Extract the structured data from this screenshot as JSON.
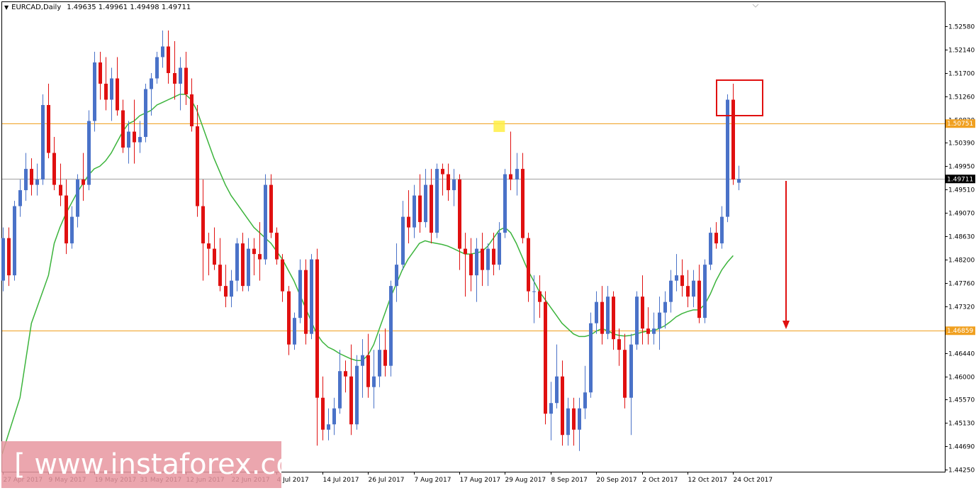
{
  "header": {
    "symbol": "EURCAD,Daily",
    "ohlc": "1.49635 1.49961 1.49498 1.49711"
  },
  "watermark": {
    "text": "[ www.instaforex.com ]"
  },
  "colors": {
    "bull": "#4a72c8",
    "bear": "#e01010",
    "ma": "#3cb43c",
    "hline": "#f0a020",
    "current": "#a0a0a0",
    "annotation": "#e01010",
    "highlight": "#ffee44"
  },
  "chart_data": {
    "type": "candlestick",
    "symbol": "EURCAD",
    "timeframe": "Daily",
    "ylim": [
      1.4425,
      1.528
    ],
    "y_ticks": [
      "1.52580",
      "1.52140",
      "1.51700",
      "1.51260",
      "1.50820",
      "1.50390",
      "1.49950",
      "1.49510",
      "1.49070",
      "1.48630",
      "1.48200",
      "1.47760",
      "1.47320",
      "1.46880",
      "1.46440",
      "1.46000",
      "1.45570",
      "1.45130",
      "1.44690",
      "1.44250"
    ],
    "x_labels": [
      "27 Apr 2017",
      "9 May 2017",
      "19 May 2017",
      "31 May 2017",
      "12 Jun 2017",
      "22 Jun 2017",
      "4 Jul 2017",
      "14 Jul 2017",
      "26 Jul 2017",
      "7 Aug 2017",
      "17 Aug 2017",
      "29 Aug 2017",
      "8 Sep 2017",
      "20 Sep 2017",
      "2 Oct 2017",
      "12 Oct 2017",
      "24 Oct 2017"
    ],
    "x_label_index": [
      0,
      8,
      16,
      24,
      32,
      40,
      48,
      56,
      64,
      72,
      80,
      88,
      96,
      104,
      112,
      120,
      128
    ],
    "horizontal_levels": [
      {
        "value": 1.50751,
        "label": "1.50751"
      },
      {
        "value": 1.46859,
        "label": "1.46859"
      }
    ],
    "current_price": {
      "value": 1.49711,
      "label": "1.49711"
    },
    "ohlc": [
      [
        1.478,
        1.488,
        1.476,
        1.486
      ],
      [
        1.486,
        1.488,
        1.477,
        1.479
      ],
      [
        1.479,
        1.493,
        1.478,
        1.492
      ],
      [
        1.492,
        1.497,
        1.49,
        1.495
      ],
      [
        1.495,
        1.502,
        1.493,
        1.499
      ],
      [
        1.499,
        1.501,
        1.494,
        1.496
      ],
      [
        1.496,
        1.5,
        1.494,
        1.497
      ],
      [
        1.497,
        1.513,
        1.496,
        1.511
      ],
      [
        1.511,
        1.515,
        1.501,
        1.502
      ],
      [
        1.502,
        1.505,
        1.495,
        1.496
      ],
      [
        1.496,
        1.5,
        1.492,
        1.494
      ],
      [
        1.494,
        1.497,
        1.483,
        1.485
      ],
      [
        1.485,
        1.492,
        1.484,
        1.49
      ],
      [
        1.49,
        1.498,
        1.488,
        1.497
      ],
      [
        1.497,
        1.502,
        1.493,
        1.496
      ],
      [
        1.496,
        1.51,
        1.495,
        1.508
      ],
      [
        1.508,
        1.521,
        1.506,
        1.519
      ],
      [
        1.519,
        1.521,
        1.512,
        1.515
      ],
      [
        1.515,
        1.52,
        1.51,
        1.512
      ],
      [
        1.512,
        1.518,
        1.508,
        1.516
      ],
      [
        1.516,
        1.52,
        1.509,
        1.51
      ],
      [
        1.51,
        1.512,
        1.502,
        1.503
      ],
      [
        1.503,
        1.508,
        1.5,
        1.506
      ],
      [
        1.506,
        1.512,
        1.5,
        1.504
      ],
      [
        1.504,
        1.508,
        1.502,
        1.505
      ],
      [
        1.505,
        1.515,
        1.504,
        1.514
      ],
      [
        1.514,
        1.517,
        1.509,
        1.516
      ],
      [
        1.516,
        1.521,
        1.515,
        1.52
      ],
      [
        1.52,
        1.525,
        1.518,
        1.522
      ],
      [
        1.522,
        1.525,
        1.515,
        1.517
      ],
      [
        1.517,
        1.523,
        1.512,
        1.515
      ],
      [
        1.515,
        1.52,
        1.51,
        1.518
      ],
      [
        1.518,
        1.521,
        1.511,
        1.513
      ],
      [
        1.513,
        1.516,
        1.506,
        1.507
      ],
      [
        1.507,
        1.511,
        1.49,
        1.492
      ],
      [
        1.492,
        1.497,
        1.478,
        1.485
      ],
      [
        1.485,
        1.487,
        1.479,
        1.484
      ],
      [
        1.484,
        1.488,
        1.48,
        1.481
      ],
      [
        1.481,
        1.486,
        1.476,
        1.477
      ],
      [
        1.477,
        1.481,
        1.473,
        1.475
      ],
      [
        1.475,
        1.48,
        1.473,
        1.478
      ],
      [
        1.478,
        1.486,
        1.476,
        1.485
      ],
      [
        1.485,
        1.487,
        1.476,
        1.477
      ],
      [
        1.477,
        1.486,
        1.476,
        1.484
      ],
      [
        1.484,
        1.486,
        1.479,
        1.483
      ],
      [
        1.483,
        1.489,
        1.478,
        1.482
      ],
      [
        1.482,
        1.498,
        1.481,
        1.496
      ],
      [
        1.496,
        1.498,
        1.486,
        1.487
      ],
      [
        1.487,
        1.488,
        1.481,
        1.482
      ],
      [
        1.482,
        1.483,
        1.474,
        1.476
      ],
      [
        1.476,
        1.477,
        1.464,
        1.466
      ],
      [
        1.466,
        1.472,
        1.465,
        1.471
      ],
      [
        1.471,
        1.482,
        1.47,
        1.48
      ],
      [
        1.48,
        1.482,
        1.466,
        1.468
      ],
      [
        1.468,
        1.483,
        1.467,
        1.482
      ],
      [
        1.482,
        1.484,
        1.447,
        1.456
      ],
      [
        1.456,
        1.46,
        1.448,
        1.45
      ],
      [
        1.45,
        1.454,
        1.448,
        1.451
      ],
      [
        1.451,
        1.456,
        1.449,
        1.454
      ],
      [
        1.454,
        1.465,
        1.453,
        1.461
      ],
      [
        1.461,
        1.463,
        1.457,
        1.46
      ],
      [
        1.46,
        1.466,
        1.449,
        1.451
      ],
      [
        1.451,
        1.464,
        1.45,
        1.462
      ],
      [
        1.462,
        1.467,
        1.456,
        1.464
      ],
      [
        1.464,
        1.468,
        1.456,
        1.458
      ],
      [
        1.458,
        1.465,
        1.454,
        1.46
      ],
      [
        1.46,
        1.468,
        1.458,
        1.465
      ],
      [
        1.465,
        1.469,
        1.46,
        1.462
      ],
      [
        1.462,
        1.478,
        1.46,
        1.477
      ],
      [
        1.477,
        1.485,
        1.474,
        1.481
      ],
      [
        1.481,
        1.493,
        1.48,
        1.49
      ],
      [
        1.49,
        1.495,
        1.485,
        1.488
      ],
      [
        1.488,
        1.496,
        1.486,
        1.494
      ],
      [
        1.494,
        1.498,
        1.487,
        1.489
      ],
      [
        1.489,
        1.499,
        1.488,
        1.496
      ],
      [
        1.496,
        1.499,
        1.485,
        1.487
      ],
      [
        1.487,
        1.5,
        1.486,
        1.499
      ],
      [
        1.499,
        1.5,
        1.494,
        1.498
      ],
      [
        1.498,
        1.5,
        1.493,
        1.495
      ],
      [
        1.495,
        1.499,
        1.492,
        1.497
      ],
      [
        1.497,
        1.498,
        1.48,
        1.484
      ],
      [
        1.484,
        1.487,
        1.475,
        1.483
      ],
      [
        1.483,
        1.486,
        1.476,
        1.479
      ],
      [
        1.479,
        1.486,
        1.474,
        1.484
      ],
      [
        1.484,
        1.487,
        1.477,
        1.48
      ],
      [
        1.48,
        1.485,
        1.477,
        1.484
      ],
      [
        1.484,
        1.487,
        1.479,
        1.481
      ],
      [
        1.481,
        1.489,
        1.48,
        1.487
      ],
      [
        1.487,
        1.499,
        1.486,
        1.498
      ],
      [
        1.498,
        1.506,
        1.495,
        1.497
      ],
      [
        1.497,
        1.502,
        1.494,
        1.499
      ],
      [
        1.499,
        1.502,
        1.485,
        1.486
      ],
      [
        1.486,
        1.487,
        1.474,
        1.476
      ],
      [
        1.476,
        1.479,
        1.47,
        1.476
      ],
      [
        1.476,
        1.479,
        1.471,
        1.474
      ],
      [
        1.474,
        1.476,
        1.451,
        1.453
      ],
      [
        1.453,
        1.459,
        1.448,
        1.455
      ],
      [
        1.455,
        1.466,
        1.454,
        1.46
      ],
      [
        1.46,
        1.463,
        1.447,
        1.449
      ],
      [
        1.449,
        1.456,
        1.447,
        1.454
      ],
      [
        1.454,
        1.456,
        1.447,
        1.45
      ],
      [
        1.45,
        1.456,
        1.446,
        1.454
      ],
      [
        1.454,
        1.462,
        1.452,
        1.457
      ],
      [
        1.457,
        1.472,
        1.456,
        1.47
      ],
      [
        1.47,
        1.476,
        1.468,
        1.474
      ],
      [
        1.474,
        1.477,
        1.466,
        1.468
      ],
      [
        1.468,
        1.477,
        1.467,
        1.475
      ],
      [
        1.475,
        1.476,
        1.465,
        1.467
      ],
      [
        1.467,
        1.469,
        1.462,
        1.465
      ],
      [
        1.465,
        1.468,
        1.454,
        1.456
      ],
      [
        1.456,
        1.468,
        1.449,
        1.466
      ],
      [
        1.466,
        1.476,
        1.465,
        1.475
      ],
      [
        1.475,
        1.479,
        1.466,
        1.469
      ],
      [
        1.469,
        1.473,
        1.466,
        1.468
      ],
      [
        1.468,
        1.472,
        1.466,
        1.469
      ],
      [
        1.469,
        1.475,
        1.465,
        1.472
      ],
      [
        1.472,
        1.476,
        1.469,
        1.474
      ],
      [
        1.474,
        1.48,
        1.472,
        1.478
      ],
      [
        1.478,
        1.483,
        1.476,
        1.479
      ],
      [
        1.479,
        1.482,
        1.475,
        1.477
      ],
      [
        1.477,
        1.48,
        1.473,
        1.475
      ],
      [
        1.475,
        1.48,
        1.473,
        1.478
      ],
      [
        1.478,
        1.481,
        1.47,
        1.471
      ],
      [
        1.471,
        1.482,
        1.47,
        1.481
      ],
      [
        1.481,
        1.488,
        1.48,
        1.487
      ],
      [
        1.487,
        1.489,
        1.484,
        1.485
      ],
      [
        1.485,
        1.492,
        1.484,
        1.49
      ],
      [
        1.49,
        1.513,
        1.489,
        1.512
      ],
      [
        1.512,
        1.515,
        1.496,
        1.497
      ],
      [
        1.4964,
        1.4996,
        1.495,
        1.4971
      ]
    ],
    "ma": [
      null,
      null,
      null,
      null,
      null,
      null,
      null,
      null,
      1.479,
      1.485,
      1.488,
      1.4905,
      1.4925,
      1.4945,
      1.4962,
      1.4978,
      1.499,
      1.4995,
      1.5005,
      1.502,
      1.504,
      1.506,
      1.5075,
      1.508,
      1.509,
      1.5095,
      1.51,
      1.511,
      1.5115,
      1.512,
      1.5125,
      1.513,
      1.513,
      1.512,
      1.51,
      1.507,
      1.504,
      1.501,
      1.4985,
      1.496,
      1.494,
      1.4925,
      1.491,
      1.4895,
      1.488,
      1.487,
      1.486,
      1.485,
      1.4835,
      1.482,
      1.48,
      1.478,
      1.4755,
      1.473,
      1.4705,
      1.468,
      1.4665,
      1.4655,
      1.465,
      1.4643,
      1.4638,
      1.4633,
      1.463,
      1.463,
      1.464,
      1.466,
      1.469,
      1.472,
      1.475,
      1.4775,
      1.48,
      1.482,
      1.4835,
      1.485,
      1.4855,
      1.4852,
      1.485,
      1.4848,
      1.4845,
      1.484,
      1.4835,
      1.483,
      1.483,
      1.4832,
      1.4835,
      1.4845,
      1.486,
      1.4875,
      1.488,
      1.487,
      1.485,
      1.4825,
      1.48,
      1.478,
      1.476,
      1.4745,
      1.473,
      1.4715,
      1.47,
      1.469,
      1.468,
      1.4675,
      1.4675,
      1.4678,
      1.4685,
      1.469,
      1.4686,
      1.468,
      1.4677,
      1.4676,
      1.4677,
      1.468,
      1.4683,
      1.4685,
      1.4686,
      1.469,
      1.4695,
      1.4703,
      1.4712,
      1.4718,
      1.4722,
      1.4725,
      1.4725,
      1.4735,
      1.4755,
      1.478,
      1.48,
      1.4815,
      1.4827,
      null
    ],
    "grid": false,
    "annotations": [
      {
        "kind": "rectangle",
        "target": "candles near 24 Oct 2017"
      },
      {
        "kind": "arrow",
        "direction": "down"
      },
      {
        "kind": "highlight",
        "target": "high near 29 Aug 2017"
      }
    ]
  }
}
